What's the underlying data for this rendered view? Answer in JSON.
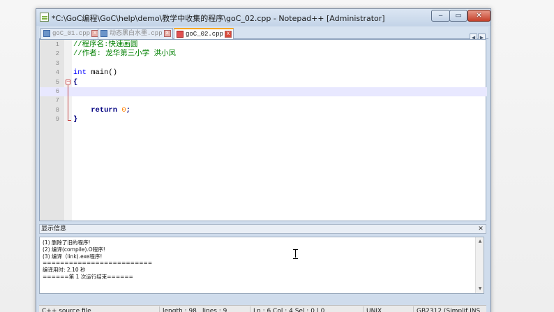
{
  "window": {
    "title": "*C:\\GoC编程\\GoC\\help\\demo\\教学中收集的程序\\goC_02.cpp - Notepad++ [Administrator]",
    "controls": {
      "minimize": "‒",
      "maximize": "▭",
      "close": "✕"
    }
  },
  "tabs": [
    {
      "label": "goC_01.cpp",
      "close": "x"
    },
    {
      "label": "动态黑白水墨.cpp",
      "close": "x"
    },
    {
      "label": "goC_02.cpp",
      "close": "x"
    }
  ],
  "tab_scroll": {
    "left": "◀",
    "right": "▶"
  },
  "editor": {
    "lines": [
      {
        "num": "1",
        "text": "//程序名:快速画圆"
      },
      {
        "num": "2",
        "text": "//作者: 龙华第三小学 洪小凤"
      },
      {
        "num": "3",
        "text": ""
      },
      {
        "num": "4",
        "text_kw": "int",
        "text_rest": " main()"
      },
      {
        "num": "5",
        "text": "{"
      },
      {
        "num": "6",
        "text": ""
      },
      {
        "num": "7",
        "text": ""
      },
      {
        "num": "8",
        "text_kw": "return",
        "text_num": "0",
        "text_end": ";"
      },
      {
        "num": "9",
        "text": "}"
      }
    ],
    "fold_open": "−"
  },
  "output_panel": {
    "title": "显示信息",
    "close": "✕",
    "lines": [
      "(1) 删除了旧的程序!",
      "(2) 编译(compile).O程序!",
      "(3) 编译（link).exe程序!",
      "=========================",
      "编译用时: 2.10 秒",
      "======第 1 次运行结束======"
    ],
    "scroll_up": "▲",
    "scroll_down": "▼"
  },
  "status_bar": {
    "file_type": "C++ source file",
    "length": "length : 98",
    "lines": "lines : 9",
    "position": "Ln : 6    Col : 4    Sel : 0 | 0",
    "eol": "UNIX",
    "encoding": "GB2312 (Simplif INS"
  }
}
